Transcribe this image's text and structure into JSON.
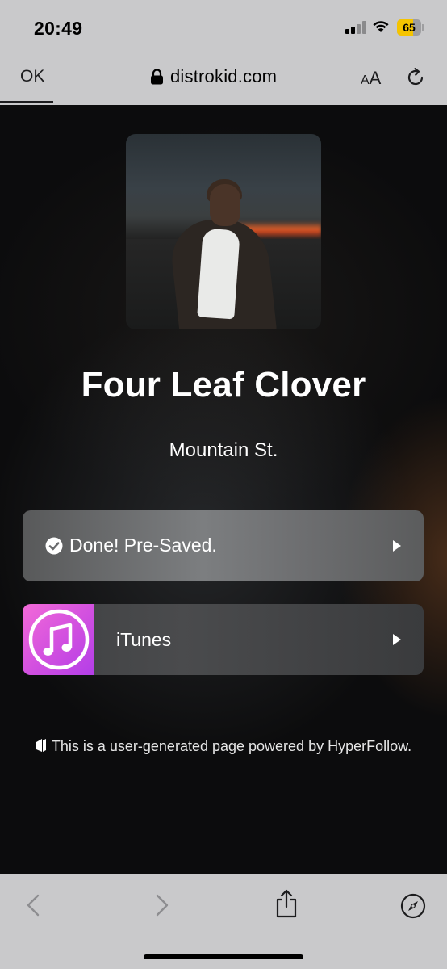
{
  "status_bar": {
    "time": "20:49",
    "battery_level": "65",
    "battery_color": "#f5c400"
  },
  "browser": {
    "ok_label": "OK",
    "domain": "distrokid.com",
    "text_size_label": "AA",
    "icons": [
      "lock-icon",
      "text-size-icon",
      "reload-icon",
      "back-icon",
      "forward-icon",
      "share-icon",
      "compass-icon"
    ]
  },
  "release": {
    "title": "Four Leaf Clover",
    "artist": "Mountain St."
  },
  "links": {
    "presave_label": "Done! Pre-Saved.",
    "itunes_label": "iTunes"
  },
  "footer": {
    "text": "This is a user-generated page powered by HyperFollow."
  },
  "colors": {
    "page_background": "#0c0c0d",
    "chrome_background": "#c9c9cb",
    "itunes_gradient_start": "#f36ad8",
    "itunes_gradient_end": "#b33ee8"
  }
}
